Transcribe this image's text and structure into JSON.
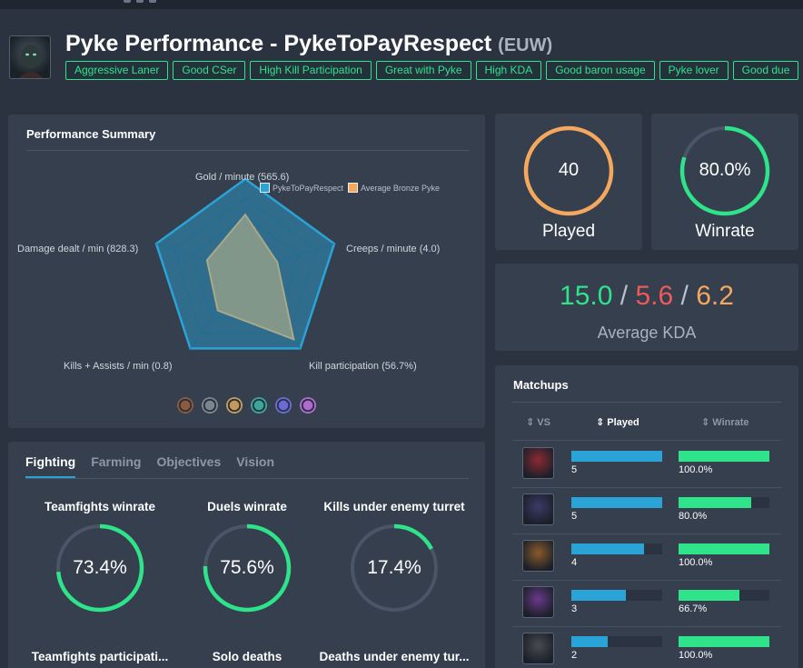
{
  "page": {
    "title": "Pyke Performance - PykeToPayRespect",
    "region": "(EUW)",
    "tags": [
      "Aggressive Laner",
      "Good CSer",
      "High Kill Participation",
      "Great with Pyke",
      "High KDA",
      "Good baron usage",
      "Pyke lover",
      "Good due"
    ]
  },
  "summary": {
    "title": "Performance Summary",
    "legend": [
      "PykeToPayRespect",
      "Average Bronze Pyke"
    ],
    "axes": [
      {
        "label": "Gold / minute (565.6)",
        "player": 1.0,
        "avg": 0.62
      },
      {
        "label": "Creeps / minute (4.0)",
        "player": 1.0,
        "avg": 0.36
      },
      {
        "label": "Kill participation (56.7%)",
        "player": 1.0,
        "avg": 0.88
      },
      {
        "label": "Kills + Assists / min (0.8)",
        "player": 1.0,
        "avg": 0.5
      },
      {
        "label": "Damage dealt / min (828.3)",
        "player": 1.0,
        "avg": 0.43
      }
    ],
    "colors": {
      "player": "#2aa3d6",
      "avg": "#f5a85d"
    },
    "ranks": [
      "#8a5a3c",
      "#7b8590",
      "#c49a5a",
      "#3aa79a",
      "#6a6ad8",
      "#b06ad0"
    ]
  },
  "fighting": {
    "tabs": [
      "Fighting",
      "Farming",
      "Objectives",
      "Vision"
    ],
    "stats": [
      {
        "label": "Teamfights winrate",
        "value": "73.4%",
        "pct": 73.4
      },
      {
        "label": "Duels winrate",
        "value": "75.6%",
        "pct": 75.6
      },
      {
        "label": "Kills under enemy turret",
        "value": "17.4%",
        "pct": 17.4
      }
    ],
    "more": [
      "Teamfights participati...",
      "Solo deaths",
      "Deaths under enemy tur..."
    ]
  },
  "played": {
    "value": "40",
    "label": "Played",
    "color": "#f5a85d"
  },
  "winrate": {
    "value": "80.0%",
    "label": "Winrate",
    "pct": 80.0,
    "color": "#2ee38a"
  },
  "kda": {
    "kills": "15.0",
    "deaths": "5.6",
    "assists": "6.2",
    "sep": "/",
    "label": "Average KDA"
  },
  "matchups": {
    "title": "Matchups",
    "headers": {
      "vs": "VS",
      "played": "Played",
      "winrate": "Winrate"
    },
    "rows": [
      {
        "played": "5",
        "played_frac": 1.0,
        "winrate": "100.0%",
        "winrate_frac": 1.0,
        "color": "#8b2a33"
      },
      {
        "played": "5",
        "played_frac": 1.0,
        "winrate": "80.0%",
        "winrate_frac": 0.8,
        "color": "#3a3b66"
      },
      {
        "played": "4",
        "played_frac": 0.8,
        "winrate": "100.0%",
        "winrate_frac": 1.0,
        "color": "#8a5a2a"
      },
      {
        "played": "3",
        "played_frac": 0.6,
        "winrate": "66.7%",
        "winrate_frac": 0.667,
        "color": "#6a3a8a"
      },
      {
        "played": "2",
        "played_frac": 0.4,
        "winrate": "100.0%",
        "winrate_frac": 1.0,
        "color": "#4a4a52"
      }
    ]
  }
}
